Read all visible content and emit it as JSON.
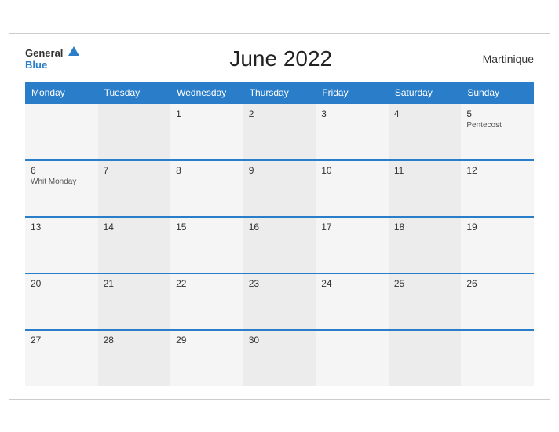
{
  "header": {
    "logo_general": "General",
    "logo_blue": "Blue",
    "title": "June 2022",
    "region": "Martinique"
  },
  "weekdays": [
    "Monday",
    "Tuesday",
    "Wednesday",
    "Thursday",
    "Friday",
    "Saturday",
    "Sunday"
  ],
  "weeks": [
    [
      {
        "day": "",
        "event": ""
      },
      {
        "day": "",
        "event": ""
      },
      {
        "day": "1",
        "event": ""
      },
      {
        "day": "2",
        "event": ""
      },
      {
        "day": "3",
        "event": ""
      },
      {
        "day": "4",
        "event": ""
      },
      {
        "day": "5",
        "event": "Pentecost"
      }
    ],
    [
      {
        "day": "6",
        "event": "Whit Monday"
      },
      {
        "day": "7",
        "event": ""
      },
      {
        "day": "8",
        "event": ""
      },
      {
        "day": "9",
        "event": ""
      },
      {
        "day": "10",
        "event": ""
      },
      {
        "day": "11",
        "event": ""
      },
      {
        "day": "12",
        "event": ""
      }
    ],
    [
      {
        "day": "13",
        "event": ""
      },
      {
        "day": "14",
        "event": ""
      },
      {
        "day": "15",
        "event": ""
      },
      {
        "day": "16",
        "event": ""
      },
      {
        "day": "17",
        "event": ""
      },
      {
        "day": "18",
        "event": ""
      },
      {
        "day": "19",
        "event": ""
      }
    ],
    [
      {
        "day": "20",
        "event": ""
      },
      {
        "day": "21",
        "event": ""
      },
      {
        "day": "22",
        "event": ""
      },
      {
        "day": "23",
        "event": ""
      },
      {
        "day": "24",
        "event": ""
      },
      {
        "day": "25",
        "event": ""
      },
      {
        "day": "26",
        "event": ""
      }
    ],
    [
      {
        "day": "27",
        "event": ""
      },
      {
        "day": "28",
        "event": ""
      },
      {
        "day": "29",
        "event": ""
      },
      {
        "day": "30",
        "event": ""
      },
      {
        "day": "",
        "event": ""
      },
      {
        "day": "",
        "event": ""
      },
      {
        "day": "",
        "event": ""
      }
    ]
  ]
}
